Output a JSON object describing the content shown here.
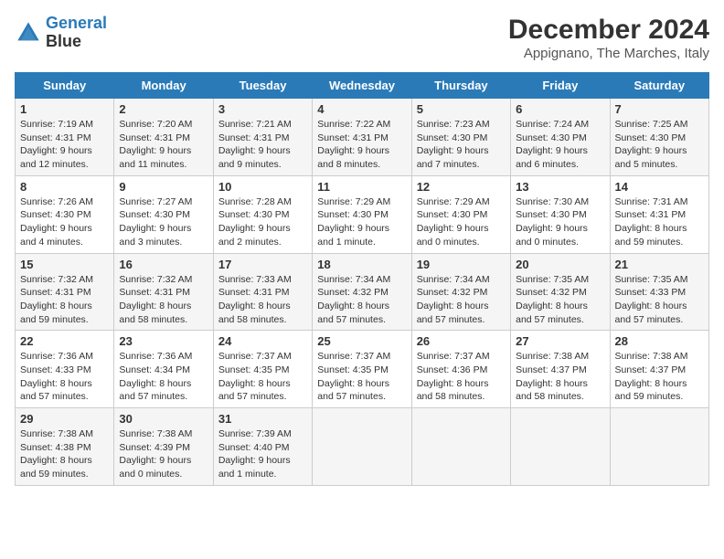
{
  "header": {
    "logo_line1": "General",
    "logo_line2": "Blue",
    "month": "December 2024",
    "location": "Appignano, The Marches, Italy"
  },
  "days_of_week": [
    "Sunday",
    "Monday",
    "Tuesday",
    "Wednesday",
    "Thursday",
    "Friday",
    "Saturday"
  ],
  "weeks": [
    [
      {
        "day": "1",
        "sunrise": "7:19 AM",
        "sunset": "4:31 PM",
        "daylight": "9 hours and 12 minutes."
      },
      {
        "day": "2",
        "sunrise": "7:20 AM",
        "sunset": "4:31 PM",
        "daylight": "9 hours and 11 minutes."
      },
      {
        "day": "3",
        "sunrise": "7:21 AM",
        "sunset": "4:31 PM",
        "daylight": "9 hours and 9 minutes."
      },
      {
        "day": "4",
        "sunrise": "7:22 AM",
        "sunset": "4:31 PM",
        "daylight": "9 hours and 8 minutes."
      },
      {
        "day": "5",
        "sunrise": "7:23 AM",
        "sunset": "4:30 PM",
        "daylight": "9 hours and 7 minutes."
      },
      {
        "day": "6",
        "sunrise": "7:24 AM",
        "sunset": "4:30 PM",
        "daylight": "9 hours and 6 minutes."
      },
      {
        "day": "7",
        "sunrise": "7:25 AM",
        "sunset": "4:30 PM",
        "daylight": "9 hours and 5 minutes."
      }
    ],
    [
      {
        "day": "8",
        "sunrise": "7:26 AM",
        "sunset": "4:30 PM",
        "daylight": "9 hours and 4 minutes."
      },
      {
        "day": "9",
        "sunrise": "7:27 AM",
        "sunset": "4:30 PM",
        "daylight": "9 hours and 3 minutes."
      },
      {
        "day": "10",
        "sunrise": "7:28 AM",
        "sunset": "4:30 PM",
        "daylight": "9 hours and 2 minutes."
      },
      {
        "day": "11",
        "sunrise": "7:29 AM",
        "sunset": "4:30 PM",
        "daylight": "9 hours and 1 minute."
      },
      {
        "day": "12",
        "sunrise": "7:29 AM",
        "sunset": "4:30 PM",
        "daylight": "9 hours and 0 minutes."
      },
      {
        "day": "13",
        "sunrise": "7:30 AM",
        "sunset": "4:30 PM",
        "daylight": "9 hours and 0 minutes."
      },
      {
        "day": "14",
        "sunrise": "7:31 AM",
        "sunset": "4:31 PM",
        "daylight": "8 hours and 59 minutes."
      }
    ],
    [
      {
        "day": "15",
        "sunrise": "7:32 AM",
        "sunset": "4:31 PM",
        "daylight": "8 hours and 59 minutes."
      },
      {
        "day": "16",
        "sunrise": "7:32 AM",
        "sunset": "4:31 PM",
        "daylight": "8 hours and 58 minutes."
      },
      {
        "day": "17",
        "sunrise": "7:33 AM",
        "sunset": "4:31 PM",
        "daylight": "8 hours and 58 minutes."
      },
      {
        "day": "18",
        "sunrise": "7:34 AM",
        "sunset": "4:32 PM",
        "daylight": "8 hours and 57 minutes."
      },
      {
        "day": "19",
        "sunrise": "7:34 AM",
        "sunset": "4:32 PM",
        "daylight": "8 hours and 57 minutes."
      },
      {
        "day": "20",
        "sunrise": "7:35 AM",
        "sunset": "4:32 PM",
        "daylight": "8 hours and 57 minutes."
      },
      {
        "day": "21",
        "sunrise": "7:35 AM",
        "sunset": "4:33 PM",
        "daylight": "8 hours and 57 minutes."
      }
    ],
    [
      {
        "day": "22",
        "sunrise": "7:36 AM",
        "sunset": "4:33 PM",
        "daylight": "8 hours and 57 minutes."
      },
      {
        "day": "23",
        "sunrise": "7:36 AM",
        "sunset": "4:34 PM",
        "daylight": "8 hours and 57 minutes."
      },
      {
        "day": "24",
        "sunrise": "7:37 AM",
        "sunset": "4:35 PM",
        "daylight": "8 hours and 57 minutes."
      },
      {
        "day": "25",
        "sunrise": "7:37 AM",
        "sunset": "4:35 PM",
        "daylight": "8 hours and 57 minutes."
      },
      {
        "day": "26",
        "sunrise": "7:37 AM",
        "sunset": "4:36 PM",
        "daylight": "8 hours and 58 minutes."
      },
      {
        "day": "27",
        "sunrise": "7:38 AM",
        "sunset": "4:37 PM",
        "daylight": "8 hours and 58 minutes."
      },
      {
        "day": "28",
        "sunrise": "7:38 AM",
        "sunset": "4:37 PM",
        "daylight": "8 hours and 59 minutes."
      }
    ],
    [
      {
        "day": "29",
        "sunrise": "7:38 AM",
        "sunset": "4:38 PM",
        "daylight": "8 hours and 59 minutes."
      },
      {
        "day": "30",
        "sunrise": "7:38 AM",
        "sunset": "4:39 PM",
        "daylight": "9 hours and 0 minutes."
      },
      {
        "day": "31",
        "sunrise": "7:39 AM",
        "sunset": "4:40 PM",
        "daylight": "9 hours and 1 minute."
      },
      null,
      null,
      null,
      null
    ]
  ]
}
